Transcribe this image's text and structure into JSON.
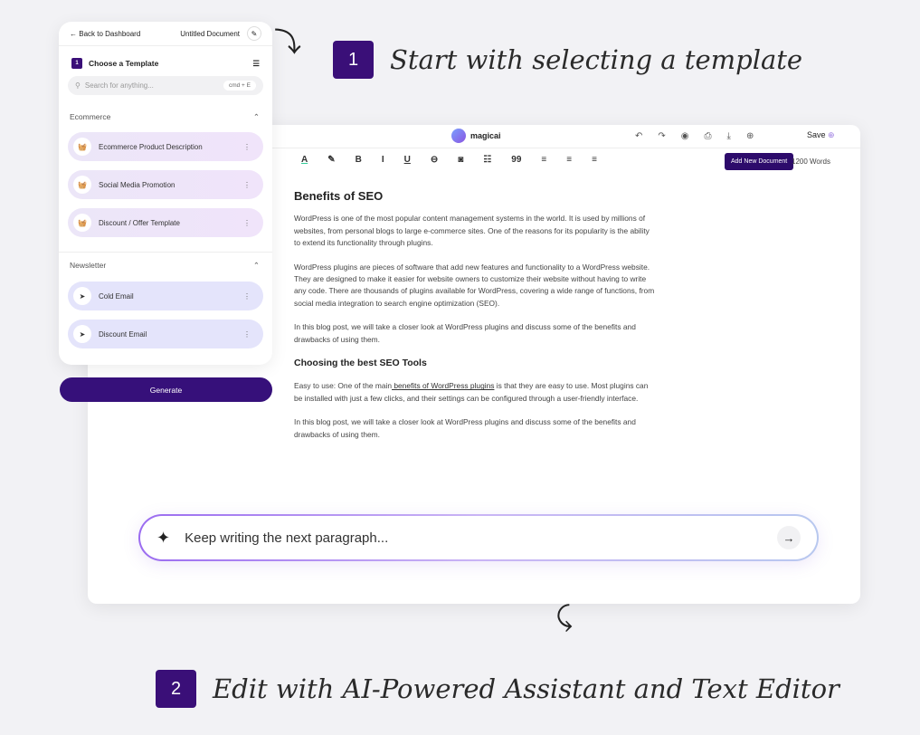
{
  "steps": [
    {
      "num": "1",
      "text": "Start with selecting a template"
    },
    {
      "num": "2",
      "text": "Edit with AI-Powered Assistant and Text Editor"
    }
  ],
  "panel": {
    "back": "Back to Dashboard",
    "doc_title": "Untitled Document",
    "step_num": "1",
    "choose": "Choose a Template",
    "search_placeholder": "Search for anything...",
    "shortcut": "cmd + E",
    "sections": [
      {
        "title": "Ecommerce",
        "items": [
          "Ecommerce Product Description",
          "Social Media Promotion",
          "Discount / Offer Template"
        ]
      },
      {
        "title": "Newsletter",
        "items": [
          "Cold Email",
          "Discount Email"
        ]
      }
    ],
    "generate": "Generate"
  },
  "editor": {
    "brand": "magicai",
    "save": "Save",
    "tooltip": "Add New Document",
    "words": "1200 Words",
    "toolbar": [
      "A",
      "✎",
      "B",
      "I",
      "U",
      "⊖",
      "◙",
      "☷",
      "99",
      "≡",
      "≡",
      "≡"
    ],
    "h1": "Benefits of SEO",
    "p1": "WordPress is one of the most popular content management systems in the world. It is used by millions of websites, from personal blogs to large e-commerce sites. One of the reasons for its popularity is the ability to extend its functionality through plugins.",
    "p2": "WordPress plugins are pieces of software that add new features and functionality to a WordPress website. They are designed to make it easier for website owners to customize their website without having to write any code. There are thousands of plugins available for WordPress, covering a wide range of functions, from social media integration to search engine optimization (SEO).",
    "p3": "In this blog post, we will take a closer look at WordPress plugins and discuss some of the benefits and drawbacks of using them.",
    "h2": "Choosing the best SEO Tools",
    "p4a": "Easy to use: One of the main",
    "p4link": " benefits of WordPress plugins",
    "p4b": " is that they are easy to use. Most plugins can be installed with just a few clicks, and their settings can be configured through a user-friendly interface.",
    "p5": "In this blog post, we will take a closer look at WordPress plugins and discuss some of the benefits and drawbacks of using them."
  },
  "prompt": {
    "placeholder": "Keep writing the next paragraph..."
  }
}
